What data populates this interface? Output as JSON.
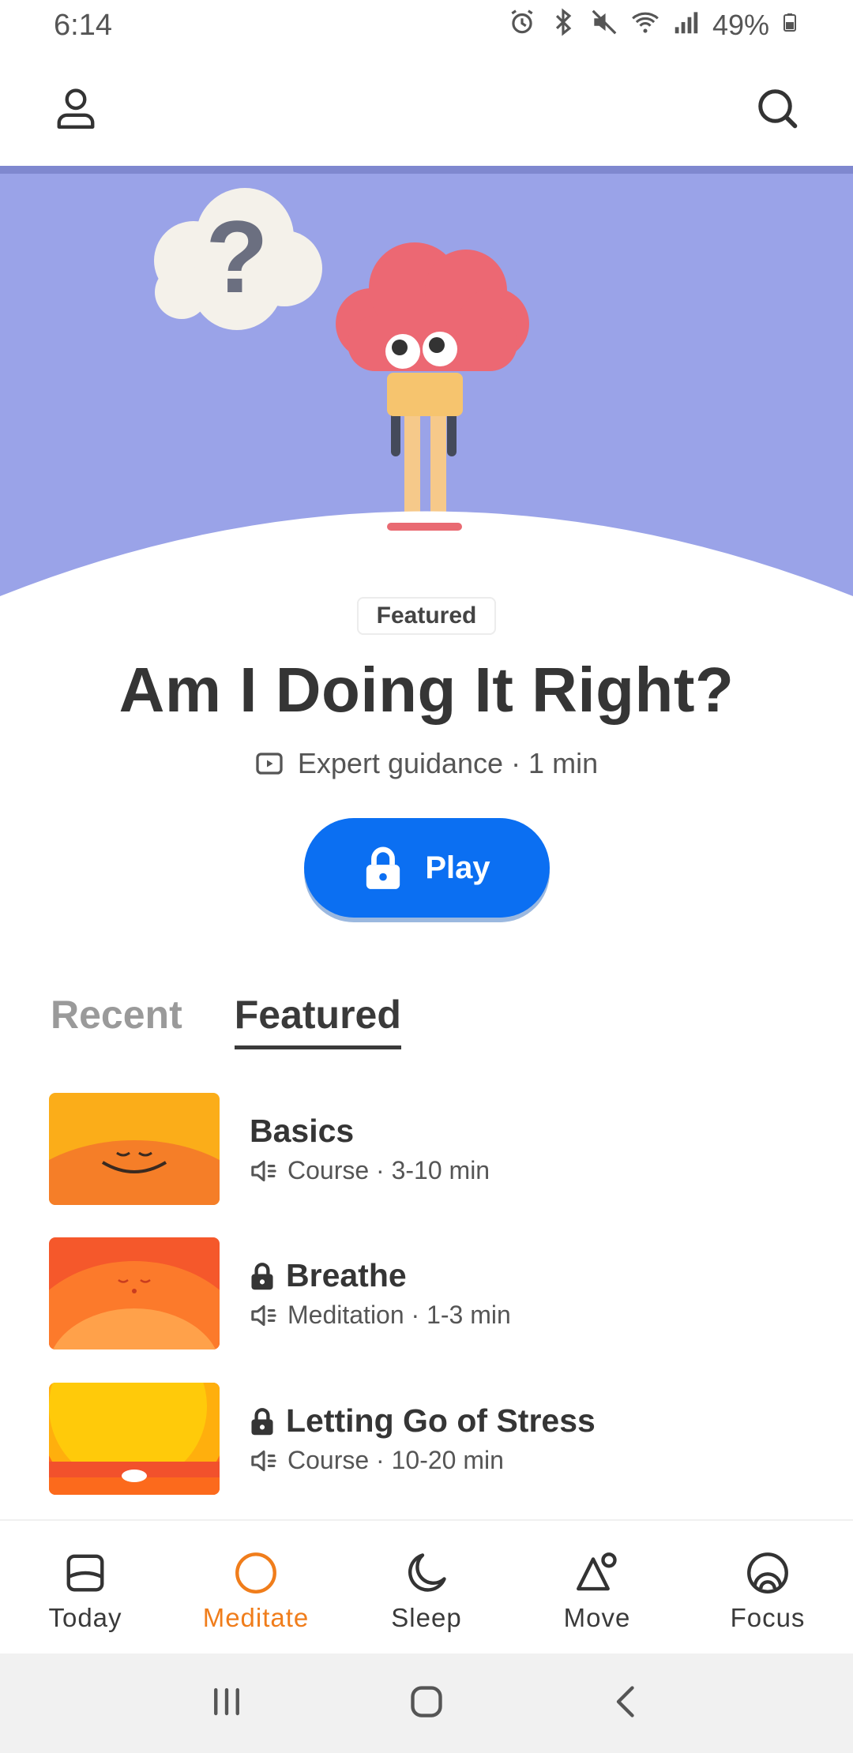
{
  "status_bar": {
    "time": "6:14",
    "battery": "49%"
  },
  "header": {
    "profile_icon": "user-icon",
    "search_icon": "search-icon"
  },
  "featured": {
    "badge": "Featured",
    "title": "Am I Doing It Right?",
    "meta": "Expert guidance · 1 min",
    "play_label": "Play"
  },
  "tabs": [
    {
      "label": "Recent"
    },
    {
      "label": "Featured"
    }
  ],
  "list": [
    {
      "title": "Basics",
      "meta": "Course · 3-10 min",
      "locked": false
    },
    {
      "title": "Breathe",
      "meta": "Meditation · 1-3 min",
      "locked": true
    },
    {
      "title": "Letting Go of Stress",
      "meta": "Course · 10-20 min",
      "locked": true
    }
  ],
  "bottom_nav": [
    {
      "label": "Today",
      "icon": "today-icon"
    },
    {
      "label": "Meditate",
      "icon": "meditate-icon"
    },
    {
      "label": "Sleep",
      "icon": "moon-icon"
    },
    {
      "label": "Move",
      "icon": "move-icon"
    },
    {
      "label": "Focus",
      "icon": "focus-icon"
    }
  ],
  "colors": {
    "accent": "#f07d1b",
    "play": "#0b6ff2",
    "hero_bg": "#9aa3e8"
  }
}
